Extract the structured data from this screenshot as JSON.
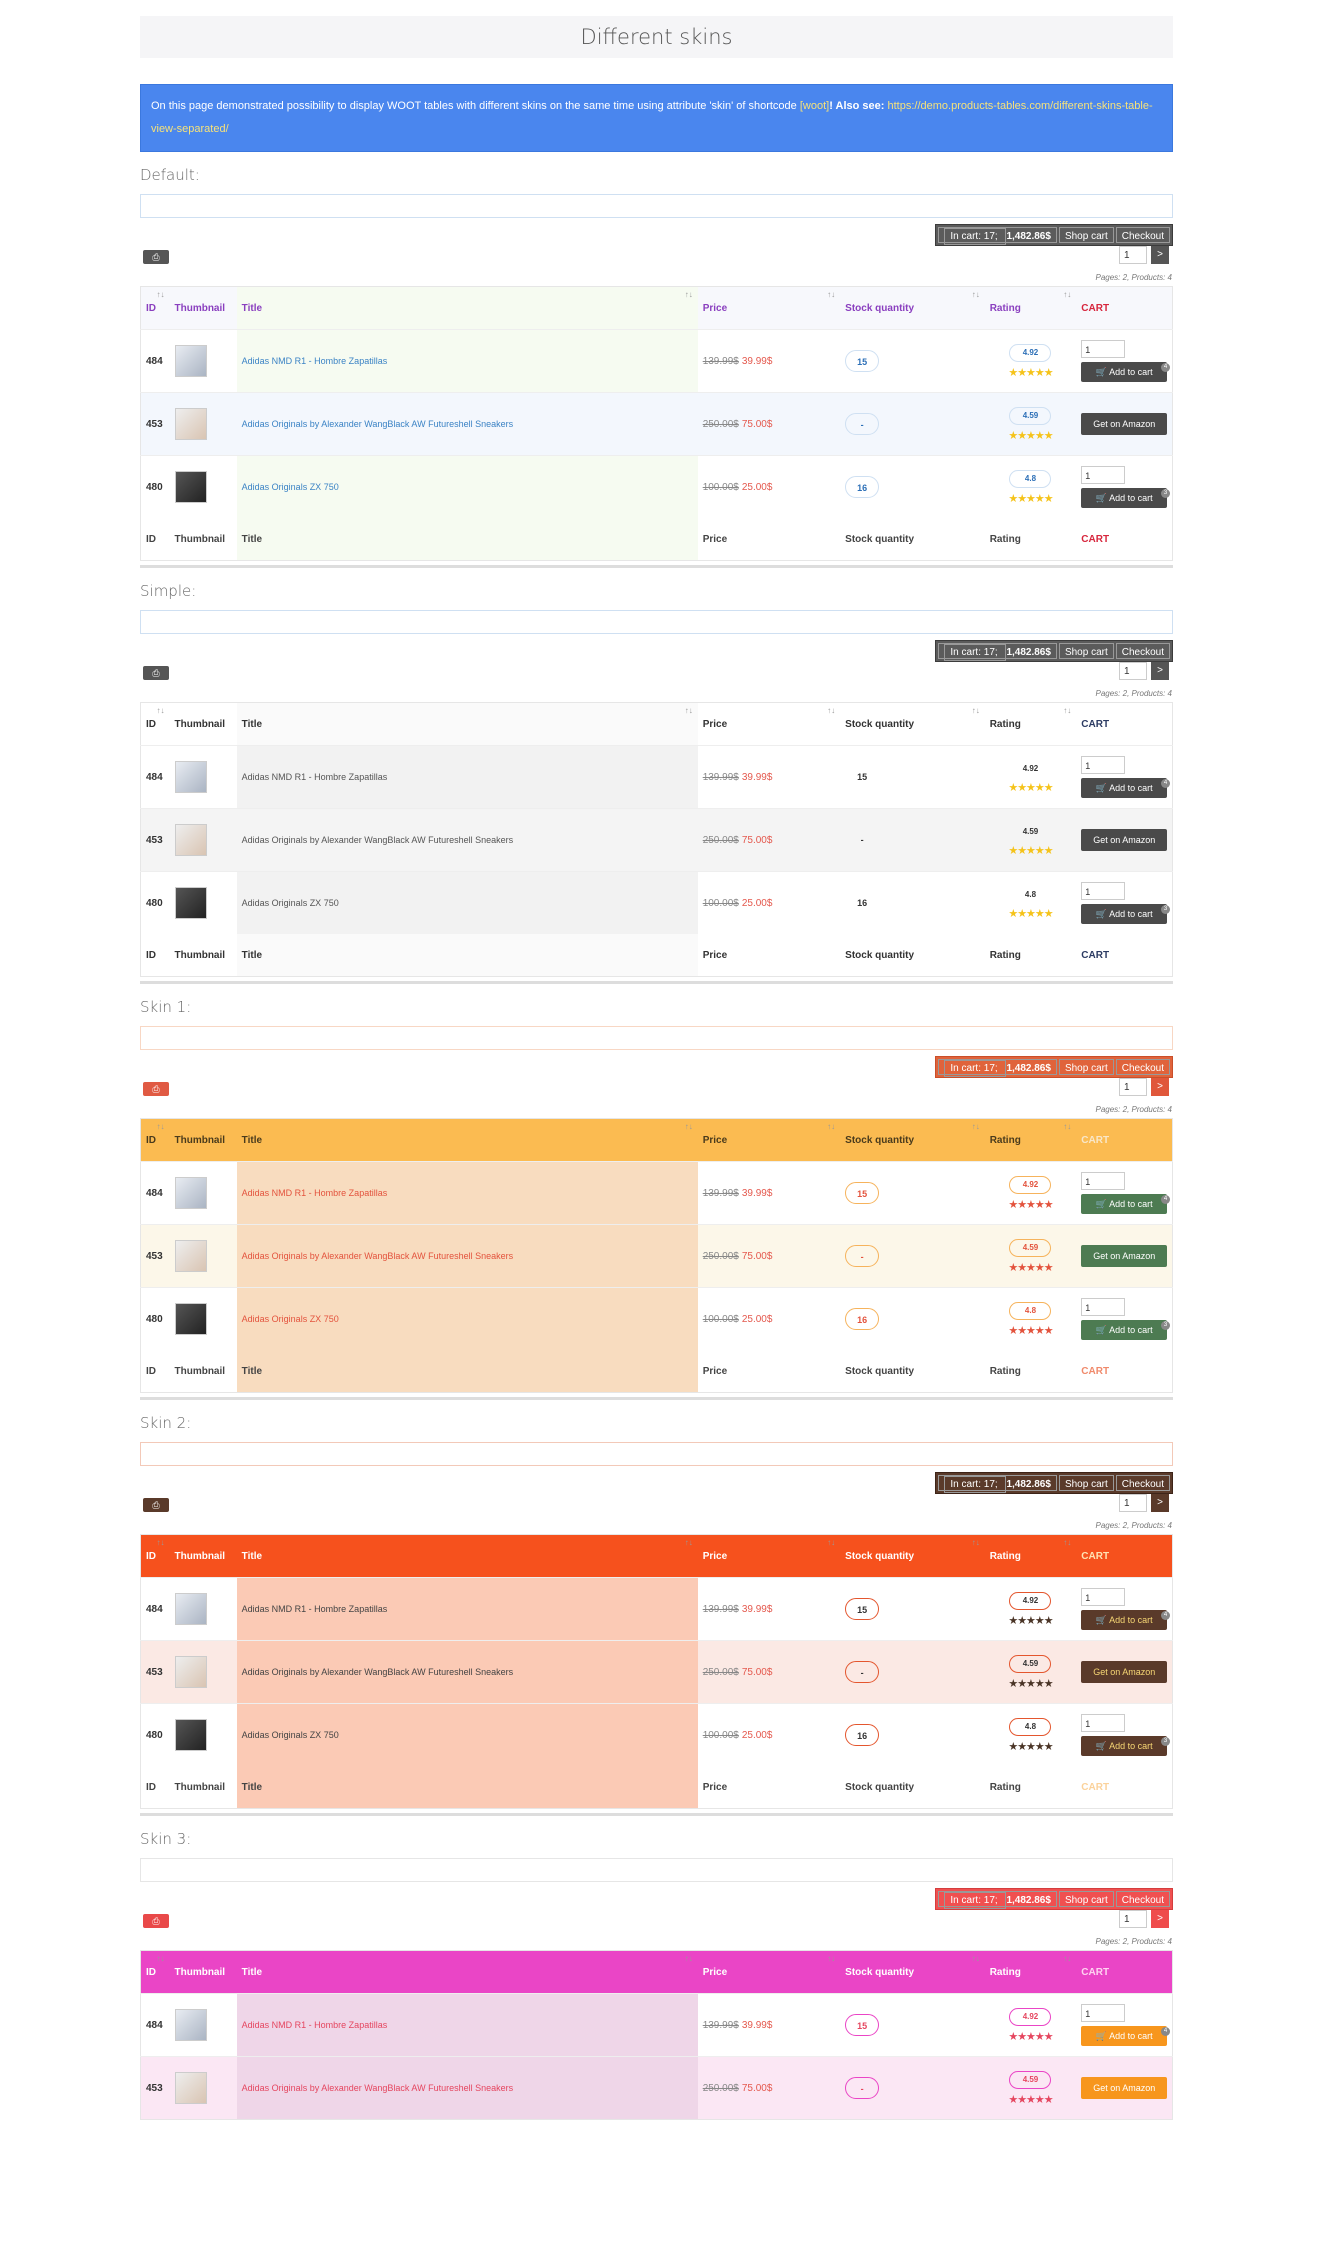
{
  "page_title": "Different skins",
  "notice": {
    "text": "On this page demonstrated possibility to display WOOT tables with different skins on the same time using attribute 'skin' of shortcode ",
    "shortcode": "[woot]",
    "also": "! Also see: ",
    "link": "https://demo.products-tables.com/different-skins-table-view-separated/"
  },
  "cart": {
    "in_cart_label": "In cart: 17; ",
    "in_cart_total": "1,482.86$",
    "shop_cart": "Shop cart",
    "checkout": "Checkout"
  },
  "pager": {
    "page_value": "1",
    "next": ">",
    "info": "Pages: 2, Products: 4"
  },
  "columns": {
    "id": "ID",
    "thumbnail": "Thumbnail",
    "title": "Title",
    "price": "Price",
    "stock": "Stock quantity",
    "rating": "Rating",
    "cart": "CART"
  },
  "buttons": {
    "add_to_cart": "Add to cart",
    "amazon": "Get on Amazon",
    "qty": "1"
  },
  "products": [
    {
      "id": "484",
      "title": "Adidas NMD R1 - Hombre Zapatillas",
      "old_price": "139.99$",
      "new_price": "39.99$",
      "stock": "15",
      "rating": "4.92",
      "stars": "★★★★★",
      "type": "cart",
      "badge": "4"
    },
    {
      "id": "453",
      "title": "Adidas Originals by Alexander WangBlack AW Futureshell Sneakers",
      "old_price": "250.00$",
      "new_price": "75.00$",
      "stock": "-",
      "rating": "4.59",
      "stars": "★★★★★",
      "type": "amazon"
    },
    {
      "id": "480",
      "title": "Adidas Originals ZX 750",
      "old_price": "100.00$",
      "new_price": "25.00$",
      "stock": "16",
      "rating": "4.8",
      "stars": "★★★★★",
      "type": "cart",
      "badge": "3"
    }
  ],
  "skins": [
    {
      "label": "Default:"
    },
    {
      "label": "Simple:"
    },
    {
      "label": "Skin 1:"
    },
    {
      "label": "Skin 2:"
    },
    {
      "label": "Skin 3:"
    }
  ],
  "colors": {
    "notice_bg": "#4a86ee",
    "skin1_header": "#fbbb51",
    "skin2_header": "#f6511d",
    "skin3_header": "#ea45c6"
  },
  "icons": {
    "print": "print-icon",
    "cart": "cart-icon",
    "sort": "sort-arrows-icon"
  }
}
